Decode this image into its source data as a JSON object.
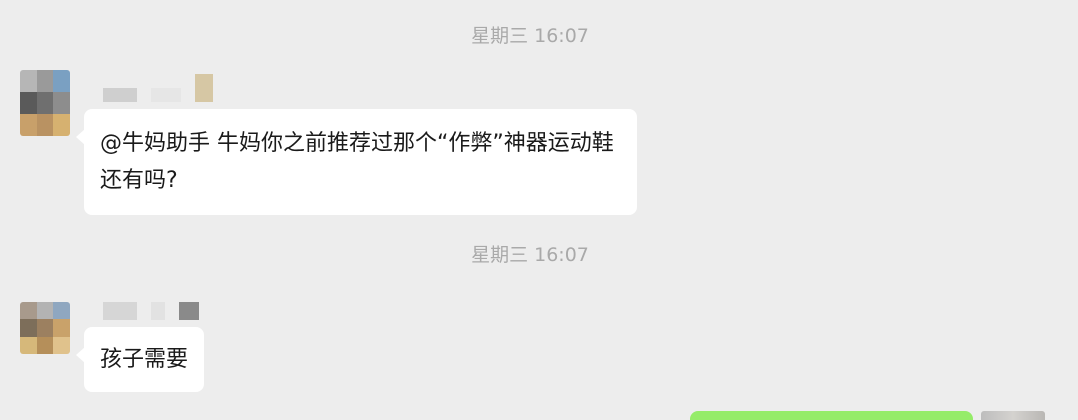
{
  "chat": {
    "messages": [
      {
        "timestamp": "星期三 16:07",
        "text": "@牛妈助手 牛妈你之前推荐过那个“作弊”神器运动鞋还有吗?",
        "avatar_colors": [
          "#b6b6b6",
          "#9a9a9a",
          "#7aa0c2",
          "#5a5a5a",
          "#6f6f6f",
          "#8d8d8d",
          "#c8a06a",
          "#b99262",
          "#d6b170"
        ],
        "nickname_colors": [
          "#cfcfcf",
          "#e6e6e6",
          "#d6c7a4"
        ]
      },
      {
        "timestamp": "星期三 16:07",
        "text": "孩子需要",
        "avatar_colors": [
          "#a89a8c",
          "#b3b3b3",
          "#8fa7c0",
          "#7d6e5a",
          "#9c8060",
          "#c9a26a",
          "#d6b87a",
          "#b58f5a",
          "#e0c28c"
        ],
        "nickname_colors": [
          "#d6d6d6",
          "#e2e2e2",
          "#8a8a8a"
        ]
      }
    ],
    "outgoing_bubble_color": "#95ec69"
  }
}
